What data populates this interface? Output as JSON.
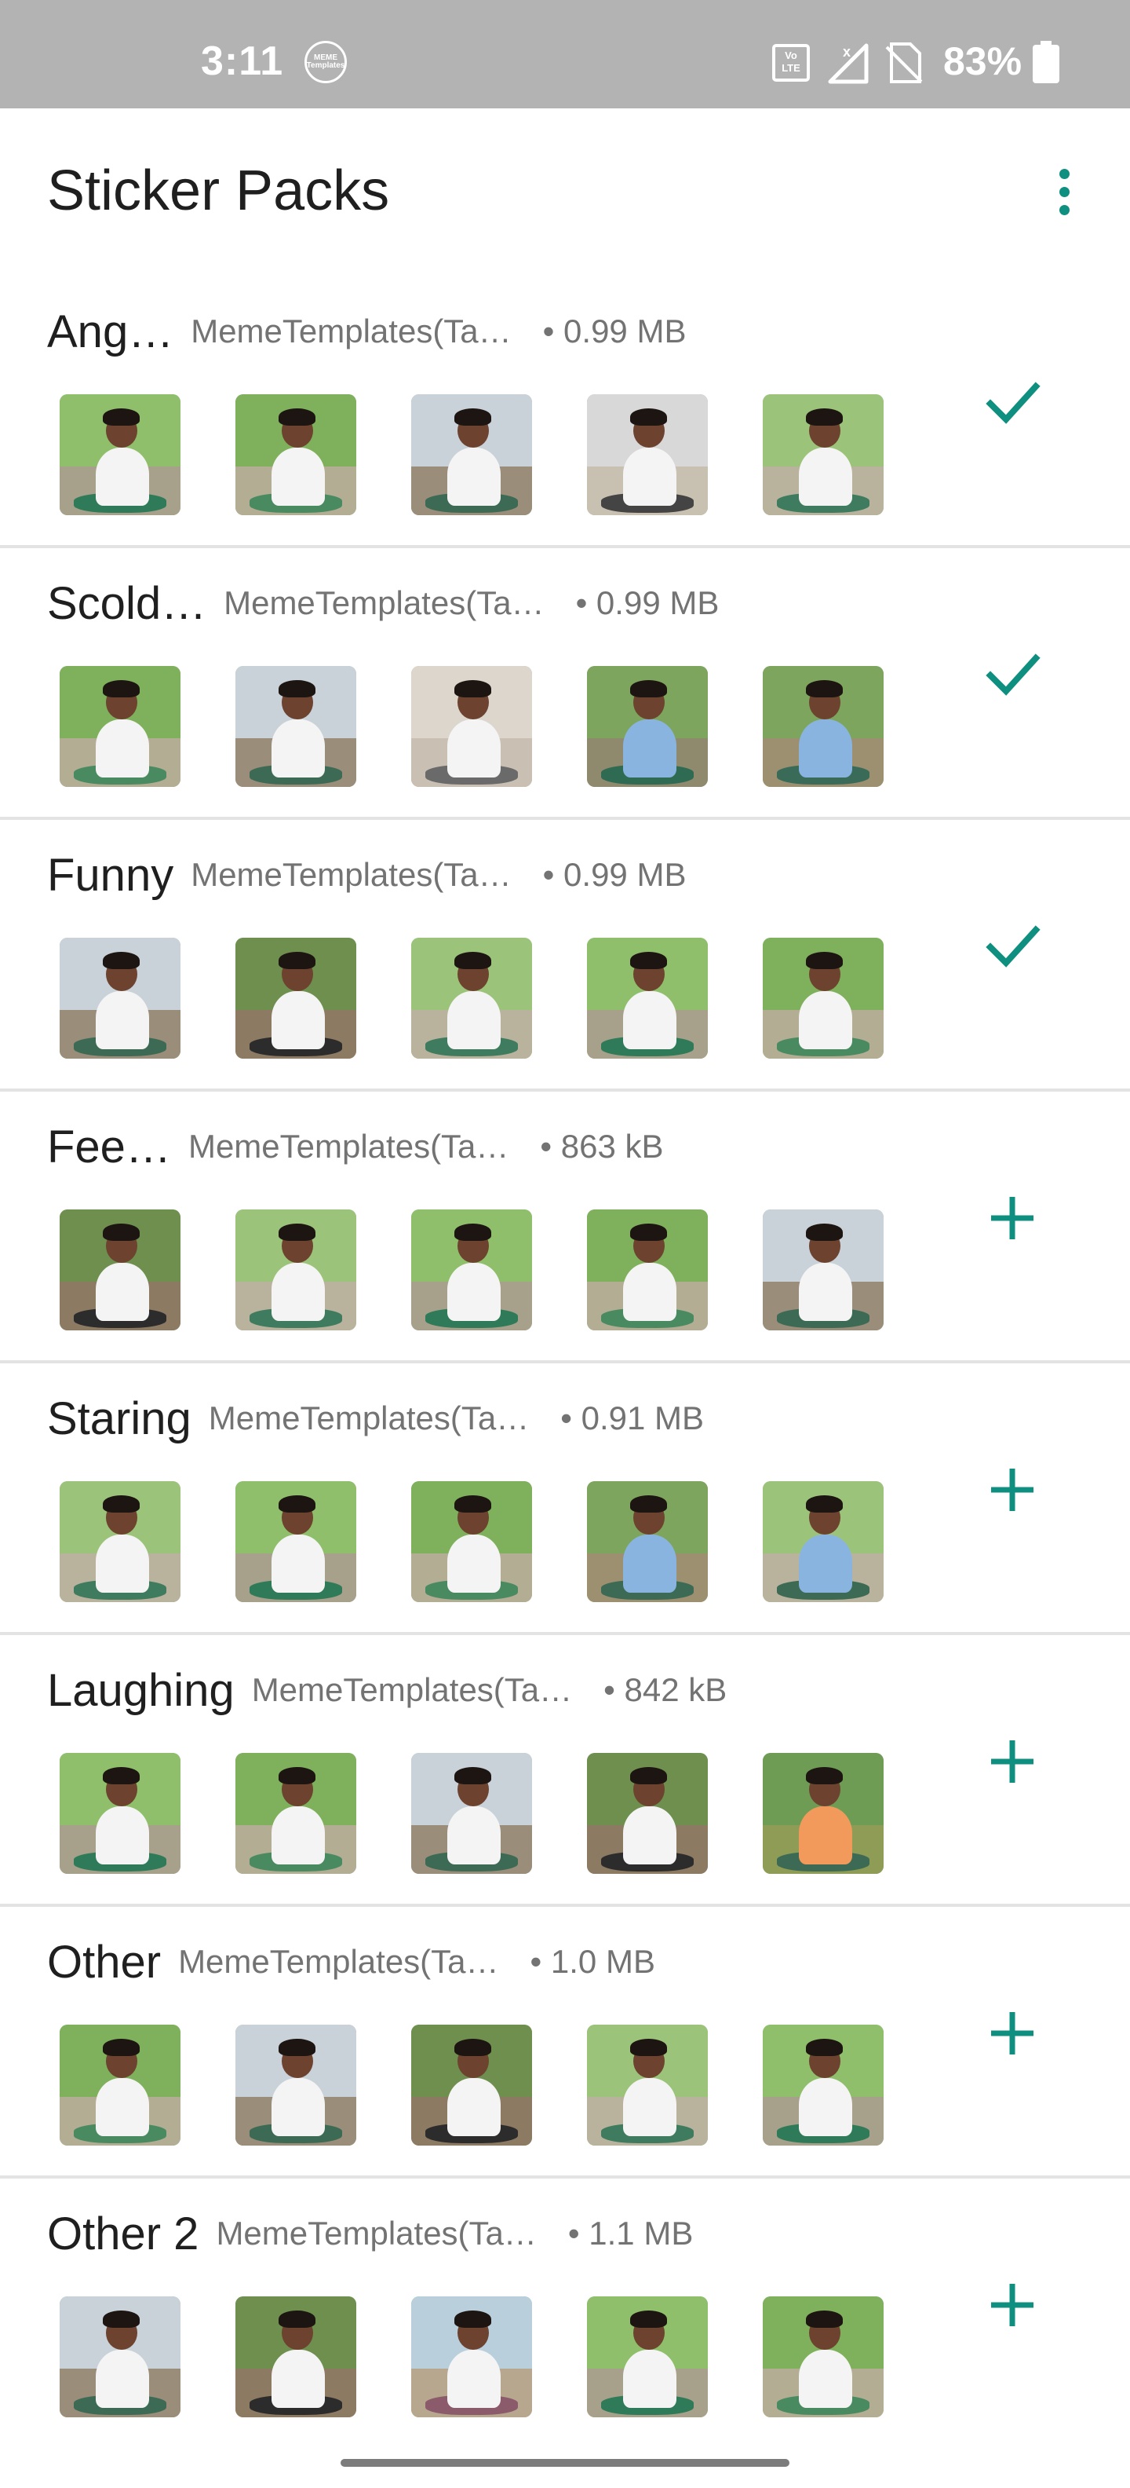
{
  "status_bar": {
    "time": "3:11",
    "app_icon_text": "MEME Templates",
    "network_badge": "Vo LTE",
    "battery_percent": "83%"
  },
  "app_bar": {
    "title": "Sticker Packs",
    "menu_icon": "more-vert-icon"
  },
  "colors": {
    "accent": "#0f8f80",
    "status_bar": "#b3b3b3",
    "divider": "#e3e3e3",
    "secondary_text": "#737373"
  },
  "packs": [
    {
      "name": "Ang…",
      "publisher": "MemeTemplates(Ta…",
      "size": "• 0.99 MB",
      "status": "added",
      "action_icon": "check-icon"
    },
    {
      "name": "Scold…",
      "publisher": "MemeTemplates(Ta…",
      "size": "• 0.99 MB",
      "status": "added",
      "action_icon": "check-icon"
    },
    {
      "name": "Funny",
      "publisher": "MemeTemplates(Ta…",
      "size": "• 0.99 MB",
      "status": "added",
      "action_icon": "check-icon"
    },
    {
      "name": "Fee…",
      "publisher": "MemeTemplates(Ta…",
      "size": "• 863 kB",
      "status": "not-added",
      "action_icon": "plus-icon"
    },
    {
      "name": "Staring",
      "publisher": "MemeTemplates(Ta…",
      "size": "• 0.91 MB",
      "status": "not-added",
      "action_icon": "plus-icon"
    },
    {
      "name": "Laughing",
      "publisher": "MemeTemplates(Ta…",
      "size": "• 842 kB",
      "status": "not-added",
      "action_icon": "plus-icon"
    },
    {
      "name": "Other",
      "publisher": "MemeTemplates(Ta…",
      "size": "• 1.0 MB",
      "status": "not-added",
      "action_icon": "plus-icon"
    },
    {
      "name": "Other 2",
      "publisher": "MemeTemplates(Ta…",
      "size": "• 1.1 MB",
      "status": "not-added",
      "action_icon": "plus-icon"
    }
  ]
}
